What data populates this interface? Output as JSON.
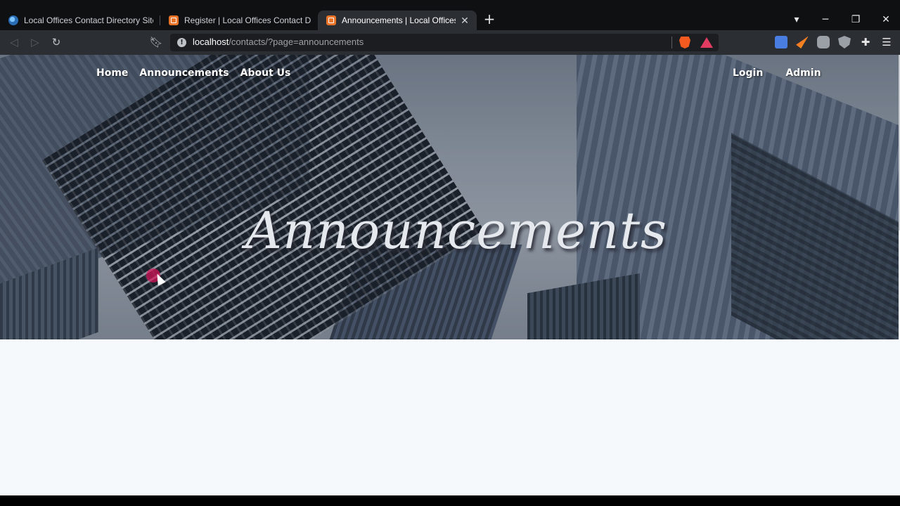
{
  "browser": {
    "tabs": [
      {
        "title": "Local Offices Contact Directory Site us",
        "favicon": "globe-icon",
        "active": false
      },
      {
        "title": "Register | Local Offices Contact Directo",
        "favicon": "xampp-icon",
        "active": false
      },
      {
        "title": "Announcements | Local Offices Co",
        "favicon": "xampp-icon",
        "active": true
      }
    ],
    "new_tab": "+",
    "window_controls": {
      "menu": "▾",
      "minimize": "─",
      "restore": "❐",
      "close": "✕"
    },
    "url": {
      "host": "localhost",
      "path": "/contacts/?page=announcements"
    }
  },
  "site": {
    "nav_left": [
      "Home",
      "Announcements",
      "About Us"
    ],
    "nav_right": [
      "Login",
      "Admin"
    ],
    "hero_title": "Announcements"
  },
  "colors": {
    "accent_tab": "#2b2e33",
    "brave": "#f25a1f",
    "page_bg": "#f6f9fb"
  }
}
